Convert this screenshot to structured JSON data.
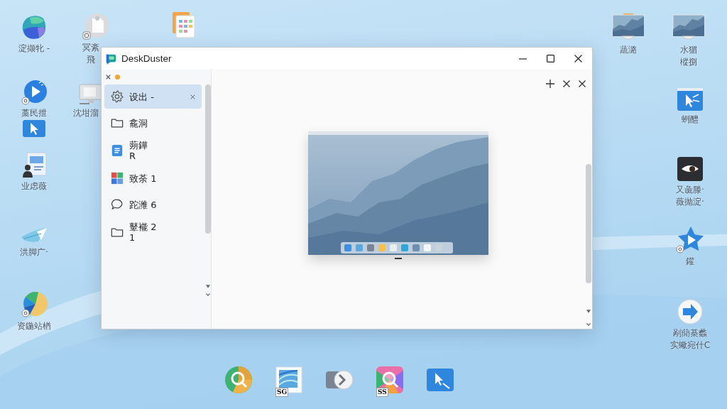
{
  "desktop_icons": [
    {
      "label": "淀撷牝 -"
    },
    {
      "label": "冥紊飛"
    },
    {
      "label": "藁民抴"
    },
    {
      "label": "沈坩溜"
    },
    {
      "label": "业虑薇"
    },
    {
      "label": "洪脚广·"
    },
    {
      "label": "资鍦站楢"
    },
    {
      "label": "蔬潞"
    },
    {
      "label": "水猸樅捌"
    },
    {
      "label": "蛚醴"
    },
    {
      "label": "又彘滕·\n薇抛淀·"
    },
    {
      "label": "鑵"
    },
    {
      "label": "剐蕑棊蠡实蠍宛什C"
    }
  ],
  "window": {
    "title": "DeskDuster",
    "sidebar": {
      "items": [
        {
          "label": "设出 -",
          "selected": true
        },
        {
          "label": "龕洞",
          "selected": false
        },
        {
          "label": "蒴鏵\nR",
          "selected": false
        },
        {
          "label": "致荼 1",
          "selected": false
        },
        {
          "label": "跎潍 6",
          "selected": false
        },
        {
          "label": "鼙褦 2\n1",
          "selected": false
        }
      ]
    }
  },
  "dock": {
    "badges": [
      "SG",
      "SS"
    ]
  }
}
